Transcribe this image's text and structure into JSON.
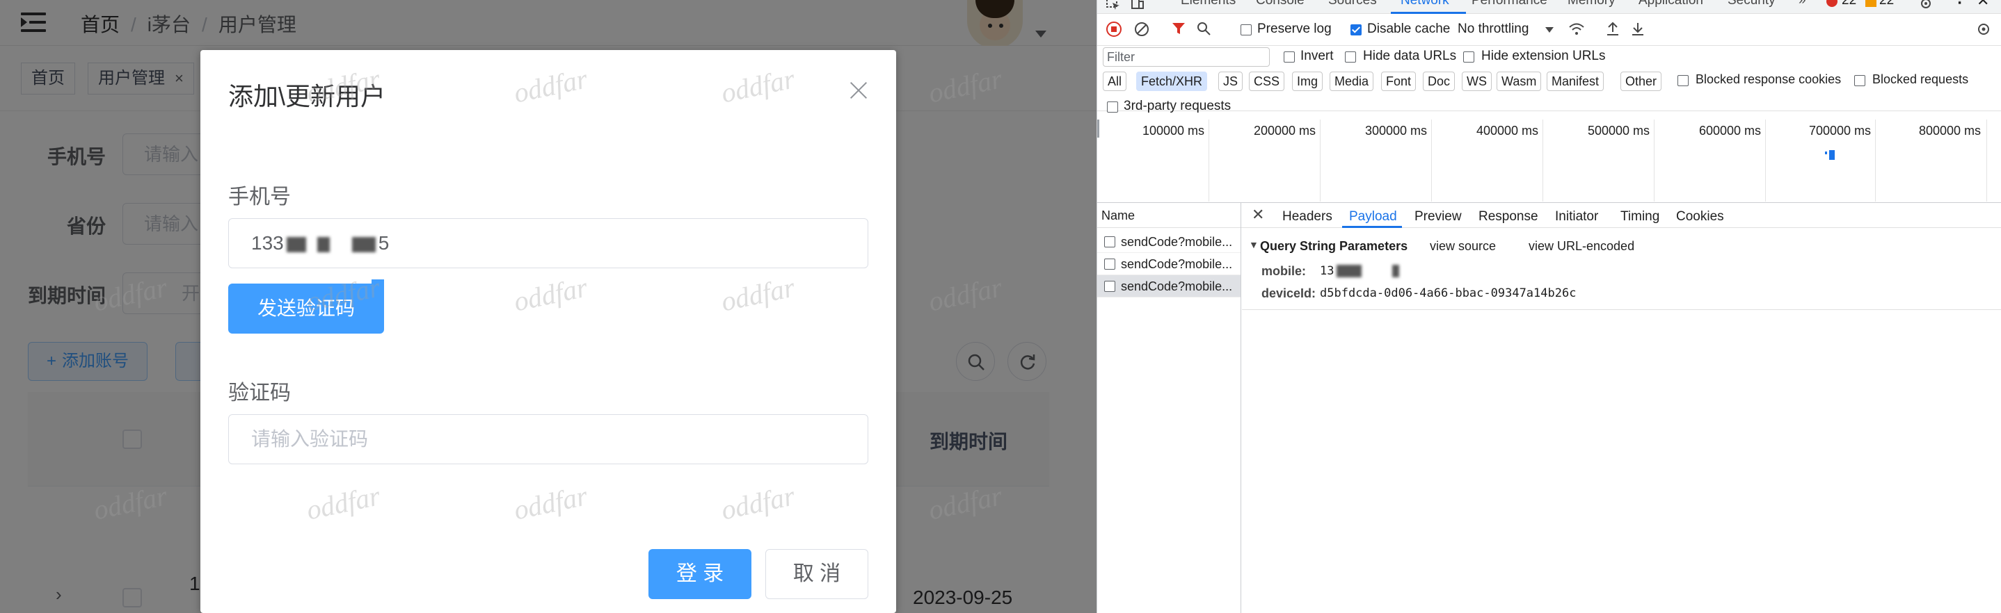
{
  "colors": {
    "primary": "#409eff",
    "devtools_accent": "#1a73e8",
    "error_badge": "#d93025",
    "warning_badge": "#f29900"
  },
  "app": {
    "breadcrumb": [
      "首页",
      "i茅台",
      "用户管理"
    ],
    "breadcrumb_sep": "/",
    "tags": [
      {
        "label": "首页"
      },
      {
        "label": "用户管理",
        "close": "×"
      }
    ],
    "search": {
      "phone_label": "手机号",
      "phone_placeholder": "请输入",
      "province_label": "省份",
      "province_placeholder": "请输入",
      "expire_label": "到期时间",
      "expire_start": "开"
    },
    "add_button": "添加账号",
    "table": {
      "expire_col": "到期时间",
      "first_row_date": "2023-09-25",
      "first_row_text": "1"
    }
  },
  "dialog": {
    "title": "添加\\更新用户",
    "phone_label": "手机号",
    "phone_value_prefix": "133",
    "phone_value_suffix": "5",
    "send_code_button": "发送验证码",
    "code_label": "验证码",
    "code_placeholder": "请输入验证码",
    "login_button": "登 录",
    "cancel_button": "取 消"
  },
  "watermark": "oddfar",
  "devtools": {
    "tabs": [
      "Elements",
      "Console",
      "Sources",
      "Network",
      "Performance",
      "Memory",
      "Application",
      "Security"
    ],
    "active_tab": "Network",
    "more_tabs": "»",
    "error_count": "22",
    "warning_count": "22",
    "toolbar": {
      "preserve_log": "Preserve log",
      "disable_cache": "Disable cache",
      "throttling": "No throttling"
    },
    "filter": {
      "placeholder": "Filter",
      "invert": "Invert",
      "hide_data_urls": "Hide data URLs",
      "hide_extension_urls": "Hide extension URLs"
    },
    "type_chips": [
      "All",
      "Fetch/XHR",
      "JS",
      "CSS",
      "Img",
      "Media",
      "Font",
      "Doc",
      "WS",
      "Wasm",
      "Manifest",
      "Other"
    ],
    "active_chip": "Fetch/XHR",
    "blocked_response_cookies": "Blocked response cookies",
    "blocked_requests": "Blocked requests",
    "third_party": "3rd-party requests",
    "overview_ticks": [
      "100000 ms",
      "200000 ms",
      "300000 ms",
      "400000 ms",
      "500000 ms",
      "600000 ms",
      "700000 ms",
      "800000 ms"
    ],
    "name_header": "Name",
    "requests": [
      "sendCode?mobile...",
      "sendCode?mobile...",
      "sendCode?mobile..."
    ],
    "detail_tabs": [
      "Headers",
      "Payload",
      "Preview",
      "Response",
      "Initiator",
      "Timing",
      "Cookies"
    ],
    "active_detail_tab": "Payload",
    "payload": {
      "section_title": "Query String Parameters",
      "view_source": "view source",
      "view_url_encoded": "view URL-encoded",
      "params": [
        {
          "key": "mobile:",
          "value": "13"
        },
        {
          "key": "deviceId:",
          "value": "d5bfdcda-0d06-4a66-bbac-09347a14b26c"
        }
      ]
    }
  }
}
